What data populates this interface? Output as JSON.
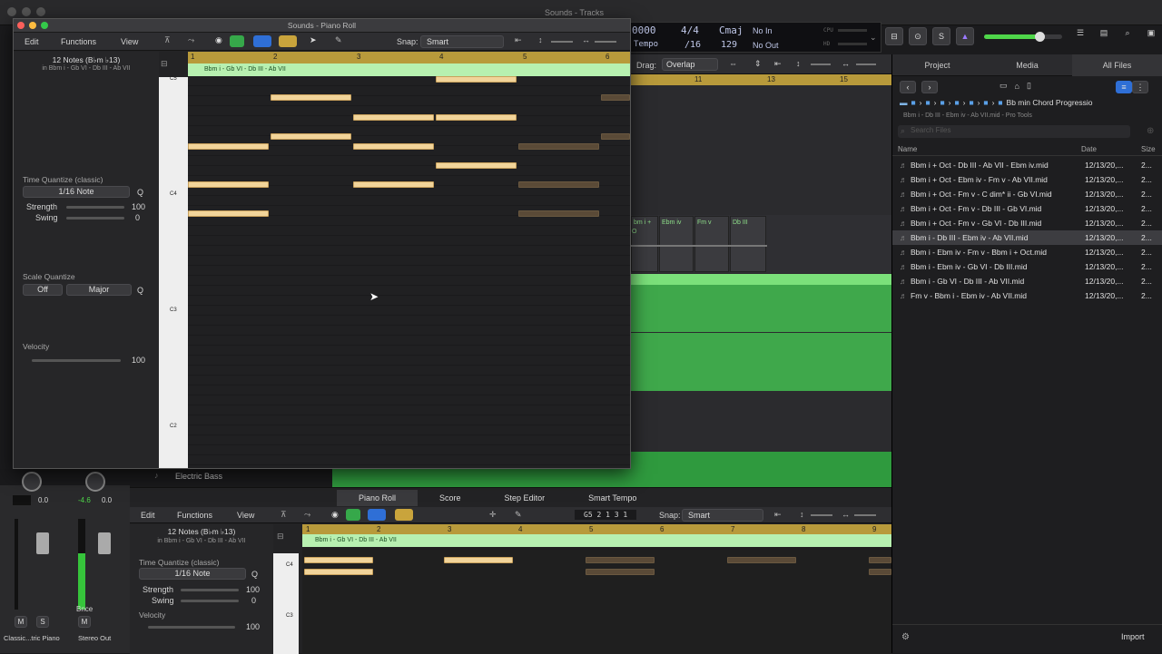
{
  "main_window": {
    "title": "Sounds - Tracks"
  },
  "lcd": {
    "bar": "0000",
    "tempo_label": "Tempo",
    "signature_top": "4/4",
    "signature_bottom": "/16",
    "key": "Cmaj",
    "tempo": "129",
    "in": "No In",
    "out": "No Out",
    "cpu": "CPU",
    "hd": "HD"
  },
  "tracks_toolbar": {
    "drag_label": "Drag:",
    "drag_value": "Overlap"
  },
  "tracks_ruler": [
    "11",
    "13",
    "15"
  ],
  "track_regions": [
    "bm i + O",
    "Ebm iv",
    "Fm v",
    "Db III"
  ],
  "browser": {
    "tabs": [
      "Project",
      "Media",
      "All Files"
    ],
    "path_title": "Bb min Chord Progressio",
    "file_caption": "Bbm i - Db III - Ebm iv - Ab VII.mid - Pro Tools",
    "search_placeholder": "Search Files",
    "columns": {
      "name": "Name",
      "date": "Date",
      "size": "Size"
    },
    "files": [
      {
        "name": "Bbm i + Oct - Db III - Ab VII - Ebm iv.mid",
        "date": "12/13/20,...",
        "size": "2..."
      },
      {
        "name": "Bbm i + Oct - Ebm iv - Fm v - Ab VII.mid",
        "date": "12/13/20,...",
        "size": "2..."
      },
      {
        "name": "Bbm i + Oct - Fm v - C dim* ii - Gb VI.mid",
        "date": "12/13/20,...",
        "size": "2..."
      },
      {
        "name": "Bbm i + Oct - Fm v - Db III - Gb VI.mid",
        "date": "12/13/20,...",
        "size": "2..."
      },
      {
        "name": "Bbm i + Oct - Fm v - Gb VI - Db III.mid",
        "date": "12/13/20,...",
        "size": "2..."
      },
      {
        "name": "Bbm i - Db III - Ebm iv - Ab VII.mid",
        "date": "12/13/20,...",
        "size": "2..."
      },
      {
        "name": "Bbm i - Ebm iv - Fm v - Bbm i + Oct.mid",
        "date": "12/13/20,...",
        "size": "2..."
      },
      {
        "name": "Bbm i - Ebm iv - Gb VI - Db III.mid",
        "date": "12/13/20,...",
        "size": "2..."
      },
      {
        "name": "Bbm i - Gb VI - Db III - Ab VII.mid",
        "date": "12/13/20,...",
        "size": "2..."
      },
      {
        "name": "Fm v - Bbm i - Ebm iv - Ab VII.mid",
        "date": "12/13/20,...",
        "size": "2..."
      }
    ],
    "import_label": "Import"
  },
  "piano_roll_window": {
    "title": "Sounds - Piano Roll",
    "menus": [
      "Edit",
      "Functions",
      "View"
    ],
    "snap_label": "Snap:",
    "snap_value": "Smart",
    "notes_count": "12 Notes (B♭m ♭13)",
    "region_location": "in Bbm i - Gb VI - Db III - Ab VII",
    "time_quantize_label": "Time Quantize (classic)",
    "quantize_value": "1/16 Note",
    "q_label": "Q",
    "strength_label": "Strength",
    "strength_value": "100",
    "swing_label": "Swing",
    "swing_value": "0",
    "scale_quantize_label": "Scale Quantize",
    "scale_off": "Off",
    "scale_major": "Major",
    "velocity_label": "Velocity",
    "velocity_value": "100",
    "region_name": "Bbm i - Gb VI - Db III - Ab VII",
    "ruler": [
      "1",
      "2",
      "3",
      "4",
      "5",
      "6"
    ],
    "key_labels": [
      "C5",
      "C4",
      "C3",
      "C2"
    ]
  },
  "mixer": {
    "track_label": "Electric Bass",
    "pan1": "0.0",
    "pan2a": "-4.6",
    "pan2b": "0.0",
    "bnce": "Bnce",
    "m": "M",
    "s": "S",
    "ch1_name": "Classic...tric Piano",
    "ch2_name": "Stereo Out"
  },
  "bottom": {
    "tabs": [
      "Piano Roll",
      "Score",
      "Step Editor",
      "Smart Tempo"
    ],
    "menus": [
      "Edit",
      "Functions",
      "View"
    ],
    "position": "G5  2 1 3 1",
    "snap_label": "Snap:",
    "snap_value": "Smart",
    "notes_count": "12 Notes (B♭m ♭13)",
    "region_location": "in Bbm i - Gb VI - Db III - Ab VII",
    "time_quantize_label": "Time Quantize (classic)",
    "quantize_value": "1/16 Note",
    "q_label": "Q",
    "strength_label": "Strength",
    "strength_value": "100",
    "swing_label": "Swing",
    "swing_value": "0",
    "velocity_label": "Velocity",
    "velocity_value": "100",
    "region_name": "Bbm i - Gb VI - Db III - Ab VII",
    "ruler": [
      "1",
      "2",
      "3",
      "4",
      "5",
      "6",
      "7",
      "8",
      "9"
    ],
    "key_labels": [
      "C4",
      "C3"
    ]
  }
}
